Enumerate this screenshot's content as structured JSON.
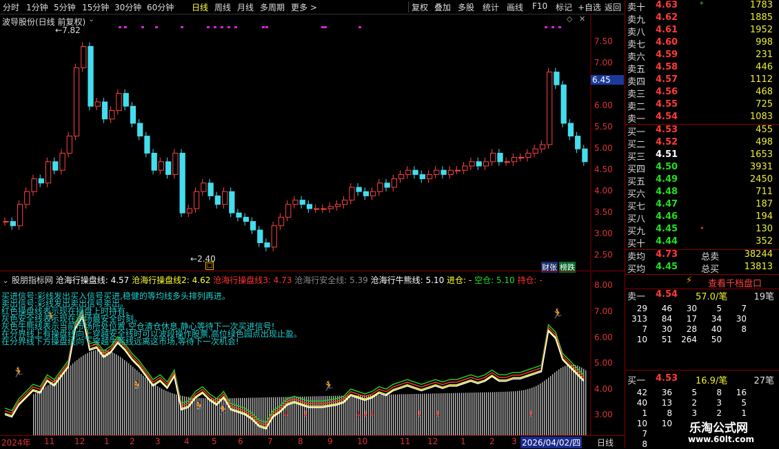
{
  "toolbar": {
    "periods": [
      "分时",
      "1分钟",
      "5分钟",
      "15分钟",
      "30分钟",
      "60分钟",
      "日线",
      "周线",
      "月线",
      "多周期",
      "更多 >"
    ],
    "active": "日线",
    "actions": [
      "复权",
      "叠加",
      "多股",
      "统计",
      "画线",
      "F10",
      "标记",
      "+自选",
      "返回"
    ]
  },
  "kline": {
    "title": "波导股份(日线 前复权)",
    "high_label": "7.82",
    "low_label": "2.40",
    "current_price_tag": "6.45",
    "y_ticks": [
      "7.50",
      "7.00",
      "6.50",
      "6.00",
      "5.50",
      "5.00",
      "4.50",
      "4.00",
      "3.50",
      "3.00",
      "2.50"
    ],
    "badges": [
      "财张",
      "榜跌"
    ]
  },
  "indicator": {
    "name": "股朋指标网",
    "lines": [
      {
        "label": "沧海行操盘线: 4.57",
        "color": "#ffffff"
      },
      {
        "label": "沧海行操盘线2: 4.62",
        "color": "#ffff33"
      },
      {
        "label": "沧海行操盘线3: 4.73",
        "color": "#ff3333"
      },
      {
        "label": "沧海行安全线: 5.39",
        "color": "#888888"
      },
      {
        "label": "沧海行牛熊线: 5.10",
        "color": "#ffffff"
      },
      {
        "label": "进仓: -",
        "color": "#ffff33"
      },
      {
        "label": "空仓: 5.10",
        "color": "#22dd22"
      },
      {
        "label": "持仓: -",
        "color": "#ff3333"
      }
    ],
    "y_ticks": [
      "8.00",
      "7.00",
      "6.00",
      "5.00",
      "4.00",
      "3.00"
    ],
    "notes": [
      "买进信号:彩线发出买入信号买进,稳健的等均线多头排列再进。",
      "卖出信号:彩线发出卖出信号卖出。",
      "红色操盘线表示现在操盘上时持有。",
      "灰色安全线表示现在进场最安全时刻。",
      "灰色牛熊线表示当前市场所处位置,空仓清仓休息,静心等待下一次买进信号!",
      "在分界线上有操盘线向上穿越安全线时可以波段操作股票,高位绿色园点出现止盈。",
      "在分界线下方操盘线向下穿越牛熊线远离这市场,等待下一次机会!"
    ]
  },
  "xaxis": {
    "labels": [
      "2024年",
      "11",
      "12",
      "1",
      "2",
      "3",
      "4",
      "5",
      "6",
      "7",
      "8",
      "9",
      "10",
      "11",
      "12",
      "1",
      "2",
      "3",
      "2026/04/02/四",
      "日线"
    ]
  },
  "orderbook": {
    "sells": [
      {
        "label": "卖十",
        "price": "4.63",
        "volume": "1783",
        "mark": "*"
      },
      {
        "label": "卖九",
        "price": "4.62",
        "volume": "1885"
      },
      {
        "label": "卖八",
        "price": "4.61",
        "volume": "1952"
      },
      {
        "label": "卖七",
        "price": "4.60",
        "volume": "998"
      },
      {
        "label": "卖六",
        "price": "4.59",
        "volume": "231"
      },
      {
        "label": "卖五",
        "price": "4.58",
        "volume": "446"
      },
      {
        "label": "卖四",
        "price": "4.57",
        "volume": "1112"
      },
      {
        "label": "卖三",
        "price": "4.56",
        "volume": "468"
      },
      {
        "label": "卖二",
        "price": "4.55",
        "volume": "725"
      },
      {
        "label": "卖一",
        "price": "4.54",
        "volume": "1083"
      }
    ],
    "buys": [
      {
        "label": "买一",
        "price": "4.53",
        "volume": "455",
        "color": "red"
      },
      {
        "label": "买二",
        "price": "4.52",
        "volume": "498",
        "color": "red"
      },
      {
        "label": "买三",
        "price": "4.51",
        "volume": "1653",
        "color": "white"
      },
      {
        "label": "买四",
        "price": "4.50",
        "volume": "3931",
        "color": "green"
      },
      {
        "label": "买五",
        "price": "4.49",
        "volume": "2450",
        "color": "green"
      },
      {
        "label": "买六",
        "price": "4.48",
        "volume": "711",
        "color": "green"
      },
      {
        "label": "买七",
        "price": "4.47",
        "volume": "187",
        "color": "green"
      },
      {
        "label": "买八",
        "price": "4.46",
        "volume": "194",
        "color": "green"
      },
      {
        "label": "买九",
        "price": "4.45",
        "volume": "130",
        "color": "green",
        "mark": "•"
      },
      {
        "label": "买十",
        "price": "4.44",
        "volume": "352",
        "color": "green"
      }
    ],
    "sell_avg": {
      "label": "卖均",
      "price": "4.73",
      "total_label": "总卖",
      "total": "38244"
    },
    "buy_avg": {
      "label": "买均",
      "price": "4.45",
      "total_label": "总买",
      "total": "13813"
    },
    "view_button": "查看千档盘口",
    "sell1_summary": {
      "label": "卖一",
      "price": "4.54",
      "avg": "57.0/笔",
      "count": "19笔"
    },
    "sell1_queue": [
      [
        "29",
        "46",
        "30",
        "5",
        "7"
      ],
      [
        "313",
        "84",
        "17",
        "34",
        "30"
      ],
      [
        "7",
        "30",
        "28",
        "40",
        "8"
      ],
      [
        "10",
        "51",
        "264",
        "50",
        ""
      ]
    ],
    "buy1_summary": {
      "label": "买一",
      "price": "4.53",
      "avg": "16.9/笔",
      "count": "27笔"
    },
    "buy1_queue": [
      [
        "42",
        "36",
        "5",
        "8",
        "16"
      ],
      [
        "40",
        "13",
        "2",
        "3",
        "5"
      ],
      [
        "1",
        "8",
        "3",
        "2",
        "1"
      ],
      [
        "10",
        "10",
        "",
        "",
        ""
      ],
      [
        "7",
        "",
        "",
        "",
        ""
      ],
      [
        "8",
        "",
        "",
        "",
        ""
      ]
    ]
  },
  "watermark": {
    "title": "乐淘公式网",
    "url": "www.60lt.com"
  },
  "colors": {
    "up": "#ff3a3a",
    "down": "#22dd22",
    "axis": "#880000",
    "cyan": "#22cccc"
  }
}
